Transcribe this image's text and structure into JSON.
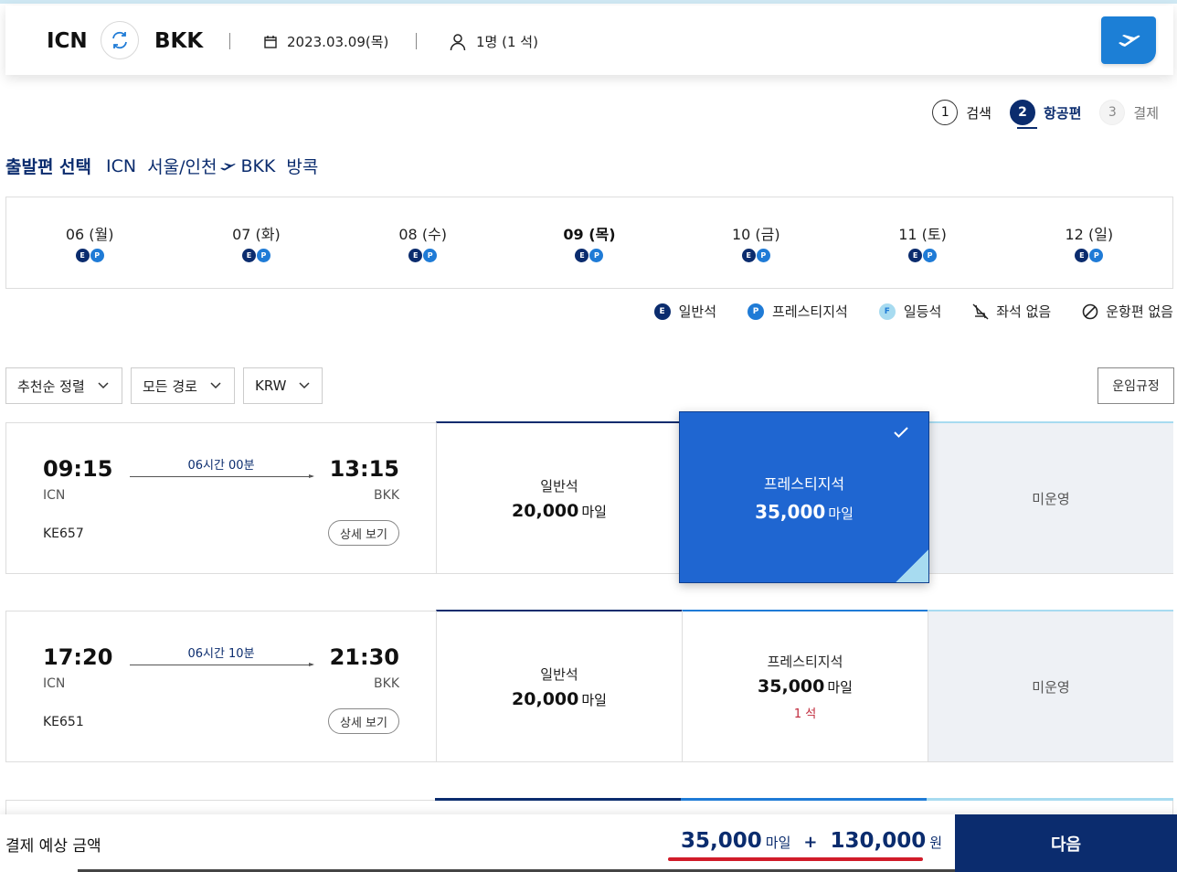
{
  "search": {
    "origin": "ICN",
    "destination": "BKK",
    "date": "2023.03.09(목)",
    "passengers": "1명 (1 석)"
  },
  "steps": [
    {
      "num": "1",
      "label": "검색",
      "state": "done"
    },
    {
      "num": "2",
      "label": "항공편",
      "state": "active"
    },
    {
      "num": "3",
      "label": "결제",
      "state": "todo"
    }
  ],
  "heading": {
    "title": "출발편 선택",
    "from_code": "ICN",
    "from_city": "서울/인천",
    "to_code": "BKK",
    "to_city": "방콕"
  },
  "dates": [
    {
      "label": "06 (월)",
      "selected": false
    },
    {
      "label": "07 (화)",
      "selected": false
    },
    {
      "label": "08 (수)",
      "selected": false
    },
    {
      "label": "09 (목)",
      "selected": true
    },
    {
      "label": "10 (금)",
      "selected": false
    },
    {
      "label": "11 (토)",
      "selected": false
    },
    {
      "label": "12 (일)",
      "selected": false
    }
  ],
  "class_badges": {
    "e": "E",
    "p": "P",
    "f": "F"
  },
  "legend": {
    "economy": "일반석",
    "prestige": "프레스티지석",
    "first": "일등석",
    "no_seat": "좌석 없음",
    "no_flight": "운항편 없음"
  },
  "filters": {
    "sort": "추천순 정렬",
    "route": "모든 경로",
    "currency": "KRW",
    "fare_rules": "운임규정"
  },
  "flights": [
    {
      "dep_time": "09:15",
      "arr_time": "13:15",
      "dep_airport": "ICN",
      "arr_airport": "BKK",
      "duration": "06시간 00분",
      "flight_no": "KE657",
      "detail": "상세 보기",
      "economy": {
        "label": "일반석",
        "miles": "20,000",
        "unit": "마일"
      },
      "prestige": {
        "label": "프레스티지석",
        "miles": "35,000",
        "unit": "마일",
        "seats": ""
      },
      "first": {
        "label": "미운영"
      }
    },
    {
      "dep_time": "17:20",
      "arr_time": "21:30",
      "dep_airport": "ICN",
      "arr_airport": "BKK",
      "duration": "06시간 10분",
      "flight_no": "KE651",
      "detail": "상세 보기",
      "economy": {
        "label": "일반석",
        "miles": "20,000",
        "unit": "마일"
      },
      "prestige": {
        "label": "프레스티지석",
        "miles": "35,000",
        "unit": "마일",
        "seats": "1 석"
      },
      "first": {
        "label": "미운영"
      }
    }
  ],
  "summary": {
    "label": "결제 예상 금액",
    "miles": "35,000",
    "miles_unit": "마일",
    "plus": "+",
    "won": "130,000",
    "won_unit": "원",
    "next": "다음"
  },
  "colors": {
    "navy": "#0b2c6e",
    "blue": "#1f7bd6",
    "selected_card": "#1f66d1",
    "light_blue": "#a7dbf0",
    "red_accent": "#d11c2a"
  }
}
